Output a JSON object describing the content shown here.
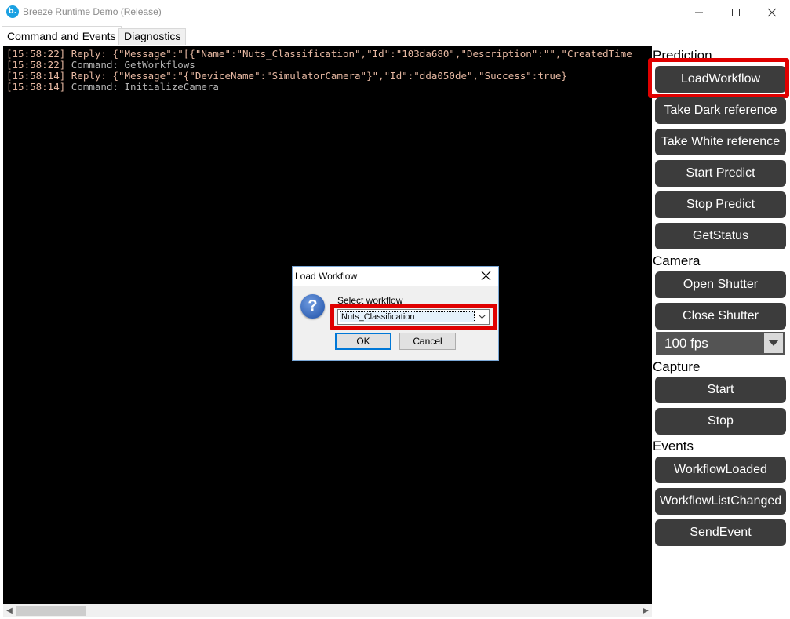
{
  "window": {
    "title": "Breeze Runtime Demo (Release)",
    "icon_letter": "b.",
    "accent_color": "#1ba1e2"
  },
  "tabs": [
    {
      "label": "Command and Events",
      "active": true
    },
    {
      "label": "Diagnostics",
      "active": false
    }
  ],
  "log": [
    {
      "ts": "[15:58:22]",
      "text": " Reply: {\"Message\":\"[{\"Name\":\"Nuts_Classification\",\"Id\":\"103da680\",\"Description\":\"\",\"CreatedTime",
      "kind": "reply"
    },
    {
      "ts": "[15:58:22]",
      "text": " Command: GetWorkflows",
      "kind": "cmd"
    },
    {
      "ts": "[15:58:14]",
      "text": " Reply: {\"Message\":\"{\"DeviceName\":\"SimulatorCamera\"}\",\"Id\":\"dda050de\",\"Success\":true}",
      "kind": "reply"
    },
    {
      "ts": "[15:58:14]",
      "text": " Command: InitializeCamera",
      "kind": "cmd"
    }
  ],
  "sections": {
    "prediction": "Prediction",
    "camera": "Camera",
    "capture": "Capture",
    "events": "Events"
  },
  "buttons": {
    "load_workflow": "LoadWorkflow",
    "take_dark": "Take Dark reference",
    "take_white": "Take White reference",
    "start_predict": "Start Predict",
    "stop_predict": "Stop Predict",
    "get_status": "GetStatus",
    "open_shutter": "Open Shutter",
    "close_shutter": "Close Shutter",
    "capture_start": "Start",
    "capture_stop": "Stop",
    "workflow_loaded": "WorkflowLoaded",
    "workflow_list_changed": "WorkflowListChanged",
    "send_event": "SendEvent"
  },
  "fps": {
    "selected": "100 fps"
  },
  "dialog": {
    "title": "Load Workflow",
    "icon": "question-icon",
    "label": "Select workflow",
    "selected_workflow": "Nuts_Classification",
    "ok": "OK",
    "cancel": "Cancel"
  },
  "highlight_color": "#e00000"
}
